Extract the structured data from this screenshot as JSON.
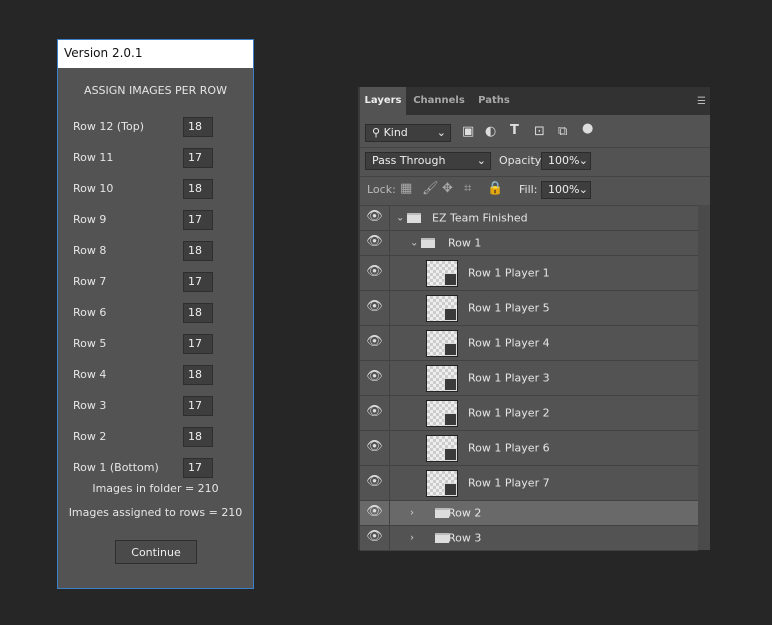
{
  "dialog": {
    "title": "Version 2.0.1",
    "heading": "ASSIGN IMAGES PER ROW",
    "rows": [
      {
        "label": "Row 12 (Top)",
        "value": "18"
      },
      {
        "label": "Row 11",
        "value": "17"
      },
      {
        "label": "Row 10",
        "value": "18"
      },
      {
        "label": "Row 9",
        "value": "17"
      },
      {
        "label": "Row 8",
        "value": "18"
      },
      {
        "label": "Row 7",
        "value": "17"
      },
      {
        "label": "Row 6",
        "value": "18"
      },
      {
        "label": "Row 5",
        "value": "17"
      },
      {
        "label": "Row 4",
        "value": "18"
      },
      {
        "label": "Row 3",
        "value": "17"
      },
      {
        "label": "Row 2",
        "value": "18"
      },
      {
        "label": "Row 1 (Bottom)",
        "value": "17"
      }
    ],
    "images_in_folder": "Images in folder = 210",
    "images_assigned": "Images assigned to rows = 210",
    "continue_label": "Continue"
  },
  "panel": {
    "tabs": [
      "Layers",
      "Channels",
      "Paths"
    ],
    "active_tab": "Layers",
    "filter": "Kind",
    "blend_mode": "Pass Through",
    "opacity_label": "Opacity:",
    "opacity": "100%",
    "lock_label": "Lock:",
    "fill_label": "Fill:",
    "fill": "100%",
    "layers": [
      {
        "name": "EZ Team Finished",
        "type": "group",
        "expanded": true,
        "indent": 0
      },
      {
        "name": "Row 1",
        "type": "group",
        "expanded": true,
        "indent": 1
      },
      {
        "name": "Row 1 Player 1",
        "type": "smart"
      },
      {
        "name": "Row 1 Player 5",
        "type": "smart"
      },
      {
        "name": "Row 1 Player 4",
        "type": "smart"
      },
      {
        "name": "Row 1 Player 3",
        "type": "smart"
      },
      {
        "name": "Row 1 Player 2",
        "type": "smart"
      },
      {
        "name": "Row 1 Player 6",
        "type": "smart"
      },
      {
        "name": "Row 1 Player 7",
        "type": "smart"
      },
      {
        "name": "Row 2",
        "type": "group",
        "expanded": false,
        "selected": true
      },
      {
        "name": "Row 3",
        "type": "group",
        "expanded": false
      }
    ]
  },
  "colors": {
    "dialog_border": "#3b7fc4",
    "panel_bg": "#535353",
    "selected_row": "#696969"
  }
}
